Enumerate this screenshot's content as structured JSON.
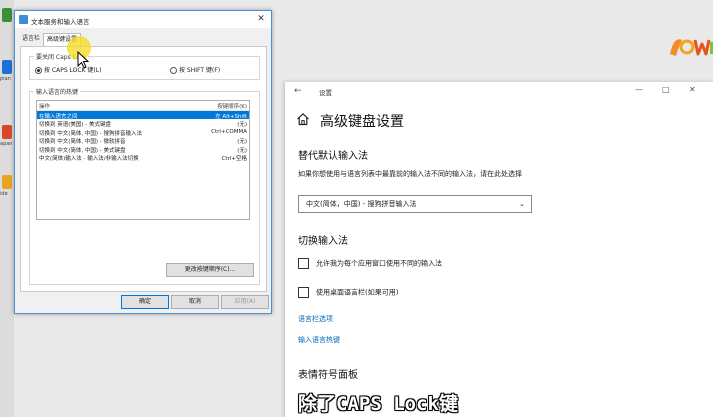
{
  "desktop": {
    "icon_labels": [
      "pian",
      "apan",
      "ide"
    ]
  },
  "dialog": {
    "title": "文本服务和输入语言",
    "close": "✕",
    "tabs": [
      "语言栏",
      "高级键设置"
    ],
    "caps_group_title": "要关闭 Caps Lock",
    "radio_caps": "按 CAPS LOCK 键(L)",
    "radio_shift": "按 SHIFT 键(F)",
    "hotkeys_group_title": "输入语言的热键",
    "columns": {
      "action": "操作",
      "keys": "按键顺序(K)"
    },
    "rows": [
      {
        "action": "在输入语言之间",
        "keys": "左 Alt+Shift"
      },
      {
        "action": "切换到 英语(美国) - 美式键盘",
        "keys": "(无)"
      },
      {
        "action": "切换到 中文(简体, 中国) - 搜狗拼音输入法",
        "keys": "Ctrl+COMMA"
      },
      {
        "action": "切换到 中文(简体, 中国) - 微软拼音",
        "keys": "(无)"
      },
      {
        "action": "切换到 中文(简体, 中国) - 美式键盘",
        "keys": "(无)"
      },
      {
        "action": "中文(简体)输入法 - 输入法/非输入法切换",
        "keys": "Ctrl+空格"
      }
    ],
    "change_sequence_button": "更改按键顺序(C)...",
    "ok_button": "确定",
    "cancel_button": "取消",
    "apply_button": "应用(A)"
  },
  "settings": {
    "window_title": "设置",
    "page_title": "高级键盘设置",
    "section_override": "替代默认输入法",
    "override_desc": "如果你想使用与语言列表中最靠前的输入法不同的输入法，请在此处选择",
    "selected_input": "中文(简体，中国) - 搜狗拼音输入法",
    "section_switch": "切换输入法",
    "checkbox_per_app": "允许我为每个应用窗口使用不同的输入法",
    "checkbox_desktop_bar": "使用桌面语言栏(如果可用)",
    "link_language_bar": "语言栏选项",
    "link_hotkeys": "输入语言热键",
    "section_emoji": "表情符号面板"
  },
  "caption": "除了CAPS Lock键"
}
